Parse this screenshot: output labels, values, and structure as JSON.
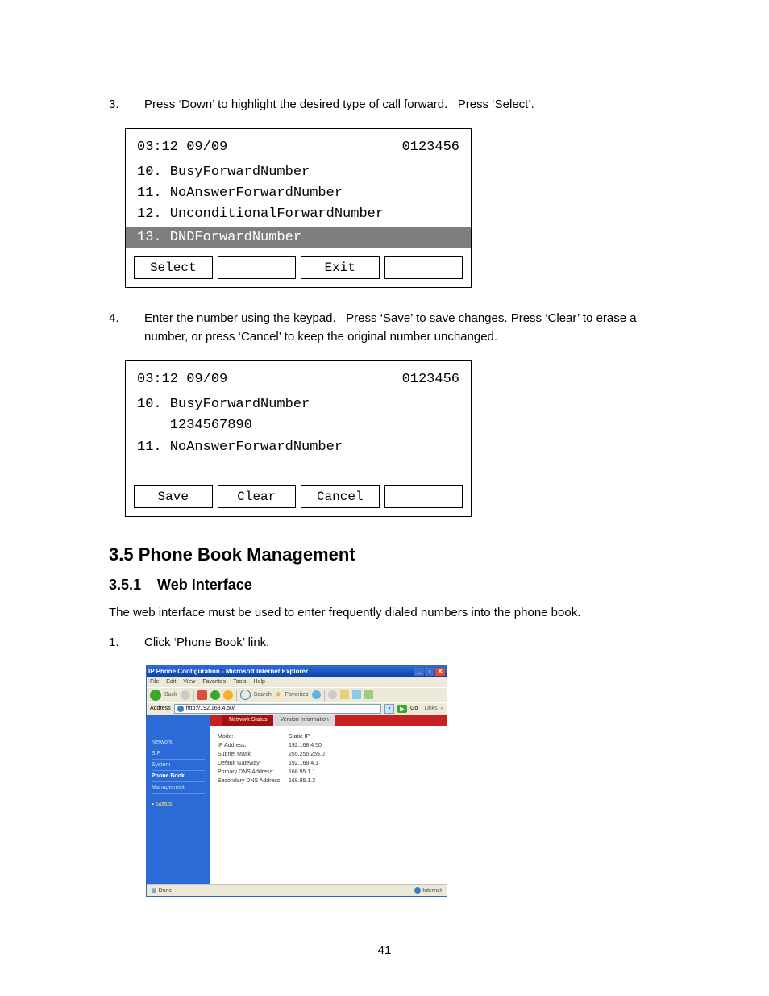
{
  "steps": {
    "s3": {
      "num": "3.",
      "text": "Press ‘Down’ to highlight the desired type of call forward.   Press ‘Select’."
    },
    "s4": {
      "num": "4.",
      "text": "Enter the number using the keypad.   Press ‘Save’ to save changes. Press ‘Clear’ to erase a number, or press ‘Cancel’ to keep the original number unchanged."
    }
  },
  "lcd1": {
    "time": "03:12 09/09",
    "id": "0123456",
    "lines": {
      "l10": "10. BusyForwardNumber",
      "l11": "11. NoAnswerForwardNumber",
      "l12": "12. UnconditionalForwardNumber",
      "sel": "13. DNDForwardNumber"
    },
    "keys": {
      "k1": "Select",
      "k2": "",
      "k3": "Exit",
      "k4": ""
    }
  },
  "lcd2": {
    "time": "03:12 09/09",
    "id": "0123456",
    "lines": {
      "l10": "10. BusyForwardNumber",
      "val": "    1234567890",
      "l11": "11. NoAnswerForwardNumber"
    },
    "keys": {
      "k1": "Save",
      "k2": "Clear",
      "k3": "Cancel",
      "k4": ""
    }
  },
  "headings": {
    "section": "3.5 Phone Book Management",
    "subsection": "3.5.1    Web Interface"
  },
  "intro": "The web interface must be used to enter frequently dialed numbers into the phone book.",
  "step1": {
    "num": "1.",
    "text": "Click ‘Phone Book’ link."
  },
  "ie": {
    "title": "IP Phone Configuration - Microsoft Internet Explorer",
    "menu": {
      "file": "File",
      "edit": "Edit",
      "view": "View",
      "fav": "Favorites",
      "tools": "Tools",
      "help": "Help"
    },
    "toolbar": {
      "back": "Back",
      "search": "Search",
      "favorites": "Favorites"
    },
    "address_label": "Address",
    "url": "http://192.168.4.50/",
    "go": "Go",
    "links": "Links",
    "tabs": {
      "active": "Network Status",
      "inactive": "Version Information"
    },
    "nav": {
      "network": "Network",
      "sip": "SIP",
      "system": "System",
      "phonebook": "Phone Book",
      "management": "Management",
      "status": "Status"
    },
    "kv": {
      "mode_k": "Mode:",
      "mode_v": "Static IP",
      "ip_k": "IP Address:",
      "ip_v": "192.168.4.50",
      "mask_k": "Subnet Mask:",
      "mask_v": "255.255.255.0",
      "gw_k": "Default Gateway:",
      "gw_v": "192.168.4.1",
      "dns1_k": "Primary DNS Address:",
      "dns1_v": "168.95.1.1",
      "dns2_k": "Secondary DNS Address:",
      "dns2_v": "168.95.1.2"
    },
    "status_done": "Done",
    "status_zone": "Internet"
  },
  "pagenum": "41"
}
